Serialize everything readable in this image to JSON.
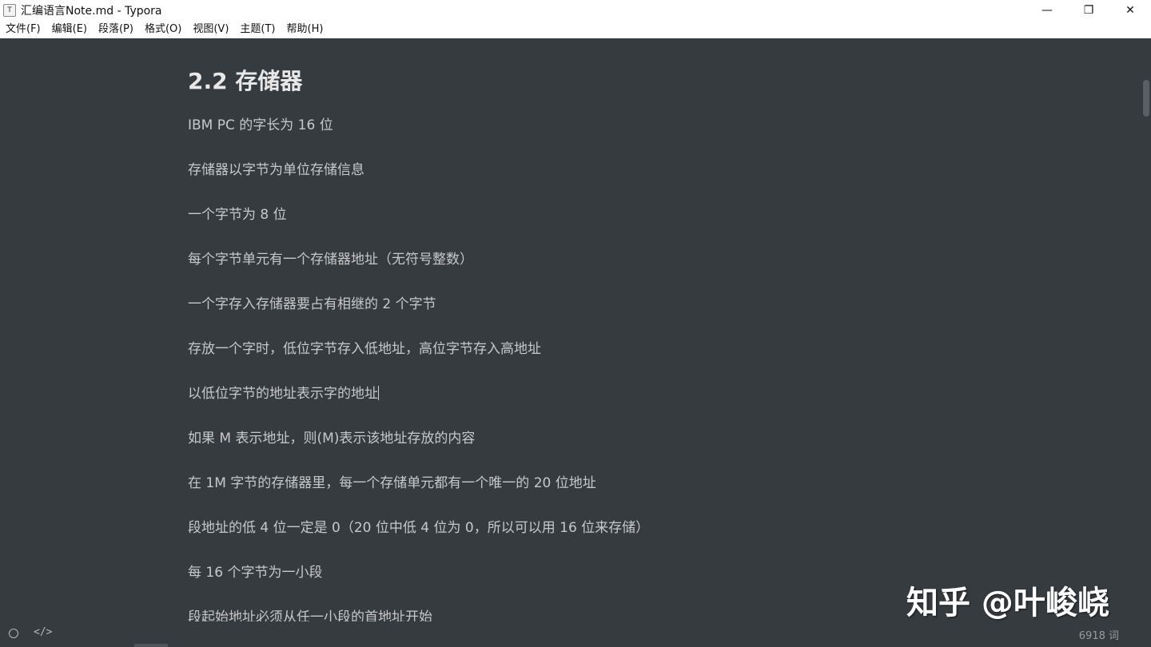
{
  "window": {
    "title": "汇编语言Note.md - Typora",
    "icon_label": "T",
    "controls": {
      "minimize": "—",
      "restore": "❐",
      "close": "✕"
    }
  },
  "menu": [
    "文件(F)",
    "编辑(E)",
    "段落(P)",
    "格式(O)",
    "视图(V)",
    "主题(T)",
    "帮助(H)"
  ],
  "document": {
    "heading": "2.2 存储器",
    "paragraphs": [
      "IBM PC 的字长为 16 位",
      "存储器以字节为单位存储信息",
      "一个字节为 8 位",
      "每个字节单元有一个存储器地址（无符号整数）",
      "一个字存入存储器要占有相继的 2 个字节",
      "存放一个字时，低位字节存入低地址，高位字节存入高地址",
      "以低位字节的地址表示字的地址",
      "如果 M 表示地址，则(M)表示该地址存放的内容",
      "在 1M 字节的存储器里，每一个存储单元都有一个唯一的 20 位地址",
      "段地址的低 4 位一定是 0（20 位中低 4 位为 0，所以可以用 16 位来存储）",
      "每 16 个字节为一小段",
      "段起始地址必须从任一小段的首地址开始"
    ]
  },
  "statusbar": {
    "code_toggle": "</>",
    "word_count": "6918 词"
  },
  "watermark": "知乎 @叶峻峣"
}
